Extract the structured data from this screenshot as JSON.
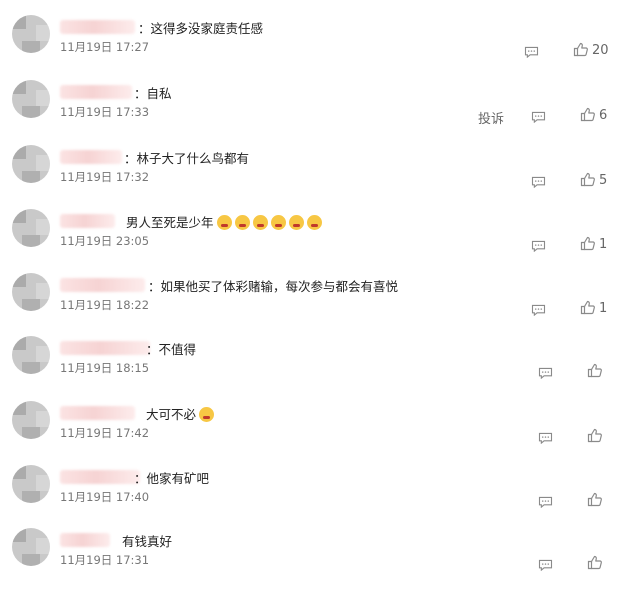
{
  "colors": {
    "text": "#222222",
    "meta": "#777777",
    "icon": "#8a8a8a",
    "name_blur": "#f6d3d3"
  },
  "icons": {
    "comment": "comment-icon",
    "like": "thumbs-up-icon",
    "emoji": "emoji-icon"
  },
  "report_label": "投诉",
  "comments": [
    {
      "prefix": "：",
      "text": "这得多没家庭责任感",
      "time": "11月19日 17:27",
      "likes": "20",
      "emoji_count": 0
    },
    {
      "prefix": "：",
      "text": "自私",
      "time": "11月19日 17:33",
      "likes": "6",
      "emoji_count": 0,
      "show_report": true
    },
    {
      "prefix": "：",
      "text": "林子大了什么鸟都有",
      "time": "11月19日 17:32",
      "likes": "5",
      "emoji_count": 0
    },
    {
      "prefix": "",
      "text": "男人至死是少年",
      "time": "11月19日 23:05",
      "likes": "1",
      "emoji_count": 6
    },
    {
      "prefix": "：",
      "text": "如果他买了体彩赌输，每次参与都会有喜悦",
      "time": "11月19日 18:22",
      "likes": "1",
      "emoji_count": 0
    },
    {
      "prefix": "：",
      "text": "不值得",
      "time": "11月19日 18:15",
      "likes": "",
      "emoji_count": 0
    },
    {
      "prefix": "",
      "text": "大可不必",
      "time": "11月19日 17:42",
      "likes": "",
      "emoji_count": 1
    },
    {
      "prefix": "：",
      "text": "他家有矿吧",
      "time": "11月19日 17:40",
      "likes": "",
      "emoji_count": 0
    },
    {
      "prefix": "",
      "text": "有钱真好",
      "time": "11月19日 17:31",
      "likes": "",
      "emoji_count": 0
    }
  ]
}
